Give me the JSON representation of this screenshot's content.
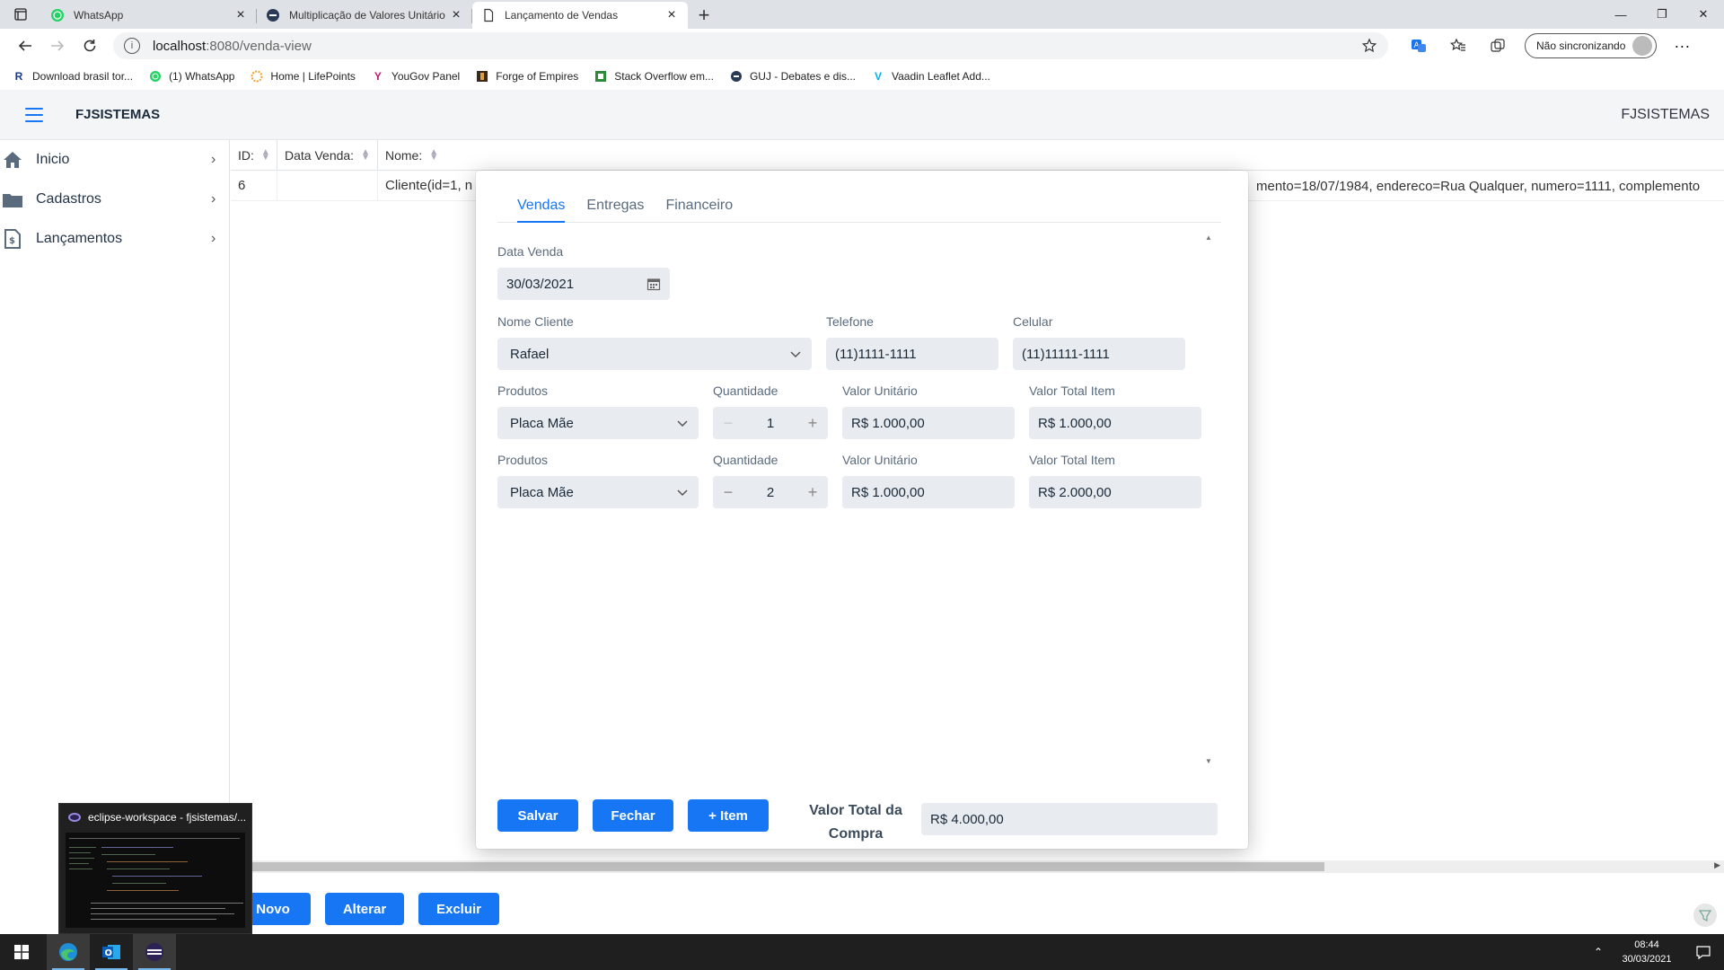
{
  "browser": {
    "tabs": [
      {
        "title": "WhatsApp",
        "active": false
      },
      {
        "title": "Multiplicação de Valores Unitário",
        "active": false
      },
      {
        "title": "Lançamento de Vendas",
        "active": true
      }
    ],
    "url_host": "localhost",
    "url_path": ":8080/venda-view",
    "sync_label": "Não sincronizando",
    "bookmarks": [
      {
        "label": "Download brasil tor..."
      },
      {
        "label": "(1) WhatsApp"
      },
      {
        "label": "Home | LifePoints"
      },
      {
        "label": "YouGov Panel"
      },
      {
        "label": "Forge of Empires"
      },
      {
        "label": "Stack Overflow em..."
      },
      {
        "label": "GUJ - Debates e dis..."
      },
      {
        "label": "Vaadin Leaflet Add..."
      }
    ]
  },
  "app": {
    "brand": "FJSISTEMAS",
    "brand_right": "FJSISTEMAS",
    "nav": [
      {
        "label": "Inicio"
      },
      {
        "label": "Cadastros"
      },
      {
        "label": "Lançamentos"
      }
    ],
    "grid": {
      "headers": [
        "ID:",
        "Data Venda:",
        "Nome:"
      ],
      "row": {
        "id": "6",
        "data": "",
        "nome_start": "Cliente(id=1, n",
        "nome_end": "mento=18/07/1984, endereco=Rua Qualquer, numero=1111, complemento"
      }
    },
    "footer_buttons": {
      "novo": "Novo",
      "alterar": "Alterar",
      "excluir": "Excluir"
    }
  },
  "dialog": {
    "tabs": [
      "Vendas",
      "Entregas",
      "Financeiro"
    ],
    "data_venda": {
      "label": "Data Venda",
      "value": "30/03/2021"
    },
    "nome_cliente": {
      "label": "Nome Cliente",
      "value": "Rafael"
    },
    "telefone": {
      "label": "Telefone",
      "value": "(11)1111-1111"
    },
    "celular": {
      "label": "Celular",
      "value": "(11)11111-1111"
    },
    "items": [
      {
        "produtos_label": "Produtos",
        "produto": "Placa Mãe",
        "qtd_label": "Quantidade",
        "quantidade": "1",
        "vu_label": "Valor Unitário",
        "valor_unitario": "R$ 1.000,00",
        "vt_label": "Valor Total Item",
        "valor_total": "R$ 1.000,00"
      },
      {
        "produtos_label": "Produtos",
        "produto": "Placa Mãe",
        "qtd_label": "Quantidade",
        "quantidade": "2",
        "vu_label": "Valor Unitário",
        "valor_unitario": "R$ 1.000,00",
        "vt_label": "Valor Total Item",
        "valor_total": "R$ 2.000,00"
      }
    ],
    "buttons": {
      "salvar": "Salvar",
      "fechar": "Fechar",
      "item": "+ Item"
    },
    "total_label": "Valor Total da Compra",
    "total_value": "R$ 4.000,00"
  },
  "preview": {
    "title": "eclipse-workspace - fjsistemas/..."
  },
  "taskbar": {
    "time": "08:44",
    "date": "30/03/2021"
  },
  "colors": {
    "primary": "#1676f3",
    "field_bg": "#e8ebef",
    "taskbar": "#1f1f1f"
  }
}
